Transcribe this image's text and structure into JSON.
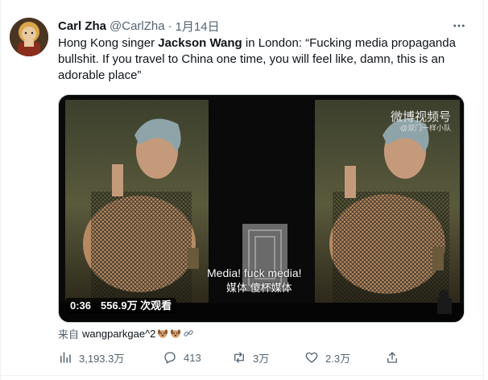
{
  "tweet": {
    "author_name": "Carl Zha",
    "author_handle": "@CarlZha",
    "separator": "·",
    "date": "1月14日",
    "text_before": "Hong Kong singer ",
    "text_bold": "Jackson Wang",
    "text_after": " in London: “Fucking media propaganda bullshit. If you travel to China one time, you will feel like, damn, this is an adorable place”"
  },
  "video": {
    "duration": "0:36",
    "views": "556.9万 次观看",
    "watermark": "微博视频号",
    "watermark_sub": "@双门一样小队",
    "subtitle_en": "Media! fuck media!",
    "subtitle_zh": "媒体 傻杯媒体"
  },
  "source": {
    "prefix": "来自",
    "account": "wangparkgae^2"
  },
  "actions": {
    "views": "3,193.3万",
    "replies": "413",
    "retweets": "3万",
    "likes": "2.3万"
  },
  "icons": {
    "more": "more-dots-icon",
    "views": "bar-chart-icon",
    "reply": "reply-bubble-icon",
    "retweet": "retweet-icon",
    "like": "heart-icon",
    "share": "share-icon"
  },
  "colors": {
    "text": "#0f1419",
    "secondary": "#536471",
    "border": "#cfd9de"
  }
}
